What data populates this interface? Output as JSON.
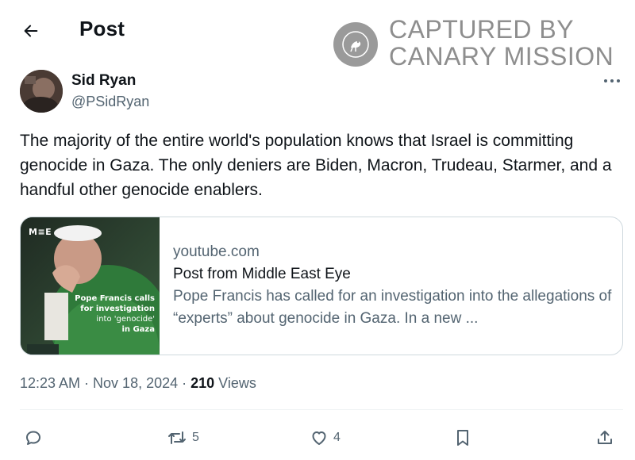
{
  "header": {
    "title": "Post"
  },
  "watermark": {
    "line1": "CAPTURED BY",
    "line2": "CANARY MISSION"
  },
  "author": {
    "name": "Sid Ryan",
    "handle": "@PSidRyan"
  },
  "tweet": {
    "text": "The majority of the entire world's population knows that Israel is committing genocide in Gaza. The only deniers are Biden, Macron, Trudeau, Starmer, and a handful other genocide enablers."
  },
  "card": {
    "domain": "youtube.com",
    "title": "Post from Middle East Eye",
    "description": "Pope Francis has called for an investigation into the allegations of “experts” about genocide in Gaza. In a new ...",
    "thumb_logo": "M≡E",
    "thumb_caption": [
      "Pope Francis calls",
      "for investigation",
      "into 'genocide'",
      "in Gaza"
    ]
  },
  "meta": {
    "time": "12:23 AM · Nov 18, 2024 · ",
    "views_count": "210",
    "views_label": " Views"
  },
  "actions": {
    "reply_count": "",
    "repost_count": "5",
    "like_count": "4"
  },
  "colors": {
    "text": "#0f1419",
    "secondary": "#536471",
    "border": "#cfd9de"
  }
}
